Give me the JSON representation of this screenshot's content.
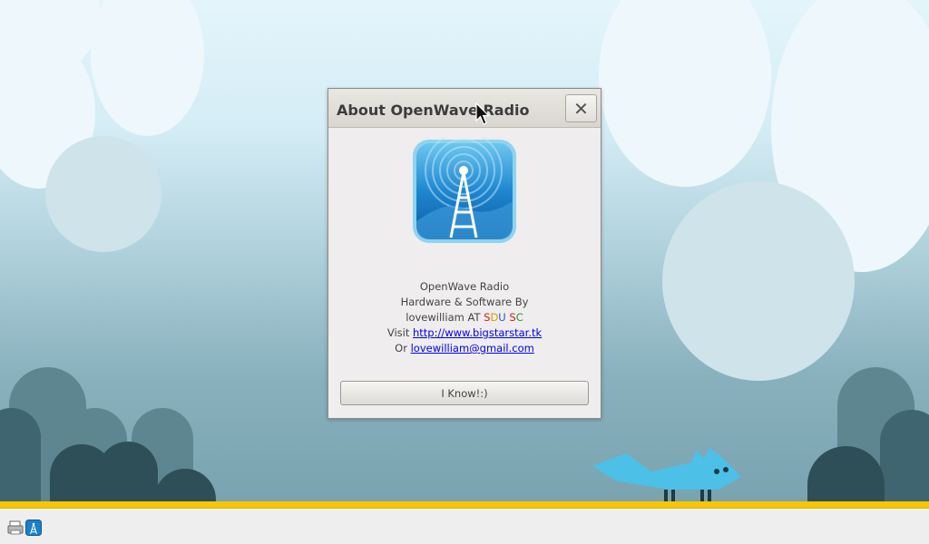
{
  "dialog": {
    "title": "About OpenWave Radio",
    "close_label": "✕",
    "app_name": "OpenWave Radio",
    "credit_line": "Hardware & Software By",
    "author_prefix": "lovewilliam AT ",
    "org_letters": [
      {
        "char": "S",
        "color": "#cc2222"
      },
      {
        "char": "D",
        "color": "#d6a000"
      },
      {
        "char": "U",
        "color": "#2255cc"
      },
      {
        "char": " ",
        "color": "#444444"
      },
      {
        "char": "S",
        "color": "#cc2222"
      },
      {
        "char": "C",
        "color": "#229933"
      }
    ],
    "visit_prefix": "Visit ",
    "website": "http://www.bigstarstar.tk",
    "or_prefix": "Or ",
    "email": "lovewilliam@gmail.com",
    "ok_label": "I Know!:)"
  },
  "taskbar": {
    "items": [
      {
        "icon": "printer-icon"
      },
      {
        "icon": "radio-tower-icon"
      }
    ]
  },
  "colors": {
    "taskbar_accent": "#f7c600",
    "app_icon_blue": "#1a7fc8",
    "fox": "#4cc0e6"
  }
}
